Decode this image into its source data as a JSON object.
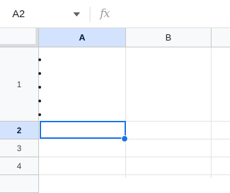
{
  "formula_bar": {
    "name_box_value": "A2",
    "fx_icon": "fx-icon",
    "dropdown_icon": "chevron-down-icon"
  },
  "grid": {
    "columns": [
      {
        "label": "A",
        "selected": true
      },
      {
        "label": "B",
        "selected": false
      }
    ],
    "rows": [
      {
        "label": "1",
        "selected": false
      },
      {
        "label": "2",
        "selected": true
      },
      {
        "label": "3",
        "selected": false
      },
      {
        "label": "4",
        "selected": false
      }
    ],
    "cells": {
      "A1": {
        "list_items": [
          "",
          "",
          "",
          "",
          ""
        ]
      },
      "A2": {
        "value": ""
      }
    },
    "active_cell": "A2"
  },
  "colors": {
    "selection_border": "#1a73e8",
    "selected_header_bg": "#d3e3fd",
    "header_bg": "#f8f9fa",
    "gridline": "#e1e1e1"
  }
}
